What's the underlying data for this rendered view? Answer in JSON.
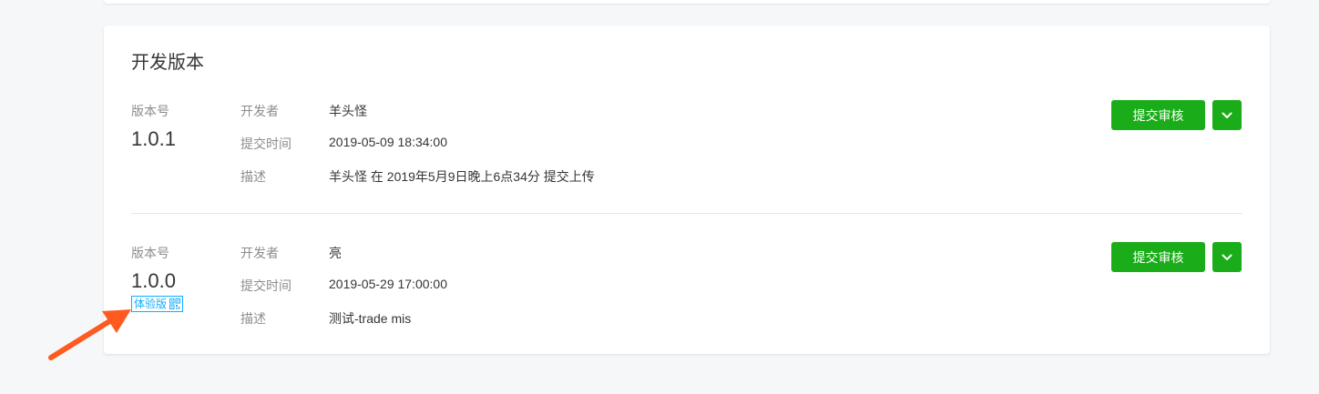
{
  "section": {
    "title": "开发版本"
  },
  "labels": {
    "version": "版本号",
    "developer": "开发者",
    "submit_time": "提交时间",
    "description": "描述",
    "submit_button": "提交审核"
  },
  "versions": [
    {
      "version": "1.0.1",
      "developer": "羊头怪",
      "submit_time": "2019-05-09 18:34:00",
      "description": "羊头怪 在 2019年5月9日晚上6点34分 提交上传"
    },
    {
      "version": "1.0.0",
      "badge": "体验版",
      "developer": "亮",
      "submit_time": "2019-05-29 17:00:00",
      "description": "测试-trade mis"
    }
  ],
  "icons": {
    "dropdown": "chevron-down-icon",
    "badge": "qrcode-icon",
    "annotation": "arrow-annotation"
  },
  "colors": {
    "primary": "#1aad19",
    "badge": "#10aeff",
    "annotation_arrow": "#ff5a1f"
  }
}
